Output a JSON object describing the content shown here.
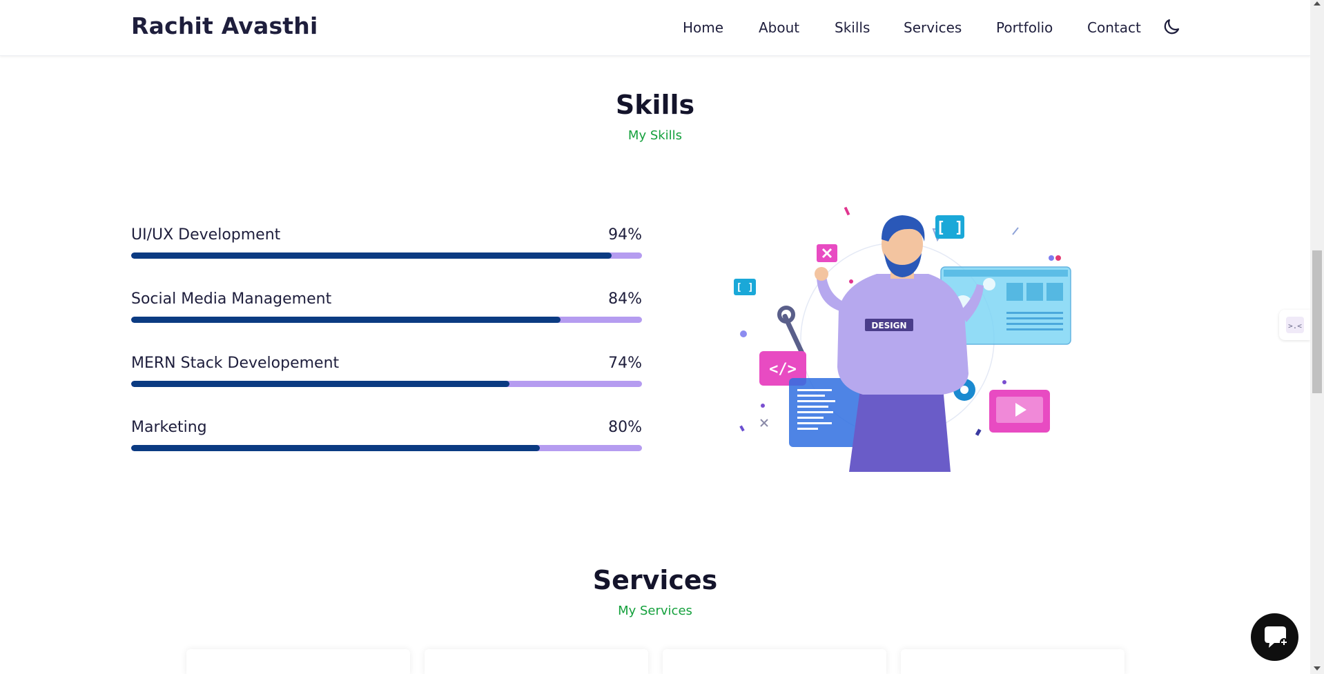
{
  "header": {
    "brand": "Rachit Avasthi",
    "nav": [
      "Home",
      "About",
      "Skills",
      "Services",
      "Portfolio",
      "Contact"
    ],
    "theme_icon": "moon-icon"
  },
  "skills_section": {
    "title": "Skills",
    "subtitle": "My Skills",
    "items": [
      {
        "name": "UI/UX Development",
        "percent_label": "94%",
        "value": 0.94
      },
      {
        "name": "Social Media Management",
        "percent_label": "84%",
        "value": 0.84
      },
      {
        "name": "MERN Stack Developement",
        "percent_label": "74%",
        "value": 0.74
      },
      {
        "name": "Marketing",
        "percent_label": "80%",
        "value": 0.8
      }
    ],
    "illustration": {
      "badge_text": "DESIGN"
    }
  },
  "services_section": {
    "title": "Services",
    "subtitle": "My Services"
  },
  "colors": {
    "accent_green": "#14a03c",
    "bar_fill": "#0b3b82",
    "bar_track": "#b59cf0",
    "heading": "#14142b"
  },
  "icons": {
    "chat": "chat-bubble-icon",
    "side_tab": "code-arrows-icon"
  }
}
